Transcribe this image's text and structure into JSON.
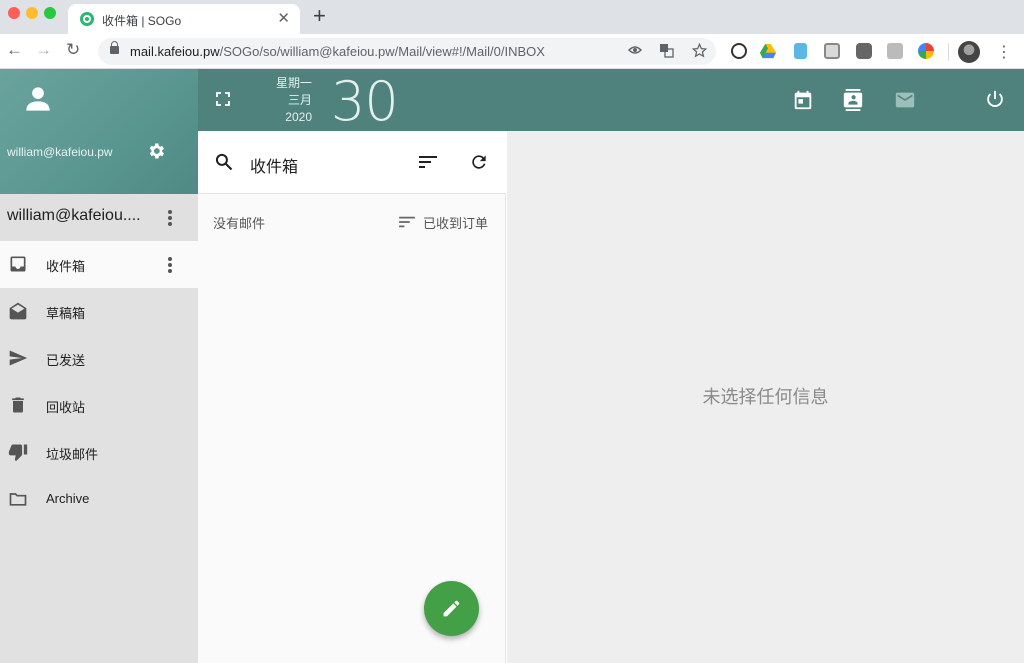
{
  "browser": {
    "tab_title": "收件箱 | SOGo",
    "tab_close": "✕",
    "new_tab": "+",
    "url_host": "mail.kafeiou.pw",
    "url_path": "/SOGo/so/william@kafeiou.pw/Mail/view#!/Mail/0/INBOX",
    "nav_back": "←",
    "nav_forward": "→",
    "nav_reload": "↻",
    "menu": "⋮",
    "traffic_colors": [
      "#ff5f57",
      "#febc2e",
      "#28c840"
    ]
  },
  "sidebar": {
    "user_email": "william@kafeiou.pw",
    "account_name": "william@kafeiou....",
    "folders": [
      {
        "label": "收件箱",
        "icon": "inbox-icon",
        "active": true
      },
      {
        "label": "草稿箱",
        "icon": "drafts-icon",
        "active": false
      },
      {
        "label": "已发送",
        "icon": "send-icon",
        "active": false
      },
      {
        "label": "回收站",
        "icon": "trash-icon",
        "active": false
      },
      {
        "label": "垃圾邮件",
        "icon": "thumb-down-icon",
        "active": false
      },
      {
        "label": "Archive",
        "icon": "folder-icon",
        "active": false
      }
    ]
  },
  "topbar": {
    "weekday": "星期一",
    "month": "三月",
    "year": "2020",
    "day": "30"
  },
  "list": {
    "title": "收件箱",
    "no_mail": "没有邮件",
    "sort_label": "已收到订单"
  },
  "detail": {
    "empty_message": "未选择任何信息"
  },
  "colors": {
    "header": "#4f827d",
    "sidebar_header": "#5f9b95",
    "fab": "#43a047"
  }
}
